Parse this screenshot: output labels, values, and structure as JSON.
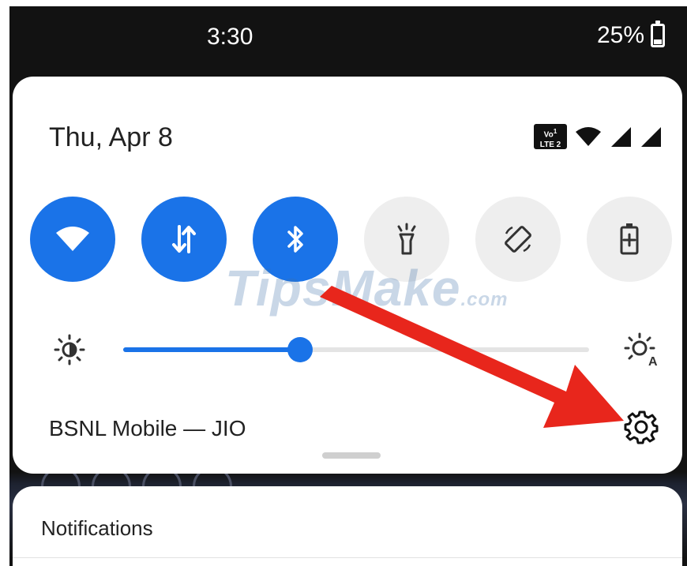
{
  "status_bar": {
    "time": "3:30",
    "battery_percent": "25%"
  },
  "quick_settings": {
    "date": "Thu, Apr 8",
    "volte_badge": {
      "top": "Vo",
      "sup": "1",
      "bottom": "LTE 2"
    },
    "tiles": [
      {
        "name": "wifi",
        "icon": "wifi-icon",
        "state": "on"
      },
      {
        "name": "mobile-data",
        "icon": "data-arrows-icon",
        "state": "on"
      },
      {
        "name": "bluetooth",
        "icon": "bluetooth-icon",
        "state": "on"
      },
      {
        "name": "flashlight",
        "icon": "flashlight-icon",
        "state": "off"
      },
      {
        "name": "auto-rotate",
        "icon": "rotate-icon",
        "state": "off"
      },
      {
        "name": "battery-saver",
        "icon": "battery-saver-icon",
        "state": "off"
      }
    ],
    "brightness": {
      "level": 0.38
    },
    "carrier": "BSNL Mobile — JIO"
  },
  "notifications": {
    "title": "Notifications"
  },
  "watermark": {
    "text": "TipsMake",
    "suffix": ".com"
  },
  "colors": {
    "accent": "#1a73e8",
    "arrow": "#e8261c",
    "tile_off": "#eeeeee"
  }
}
